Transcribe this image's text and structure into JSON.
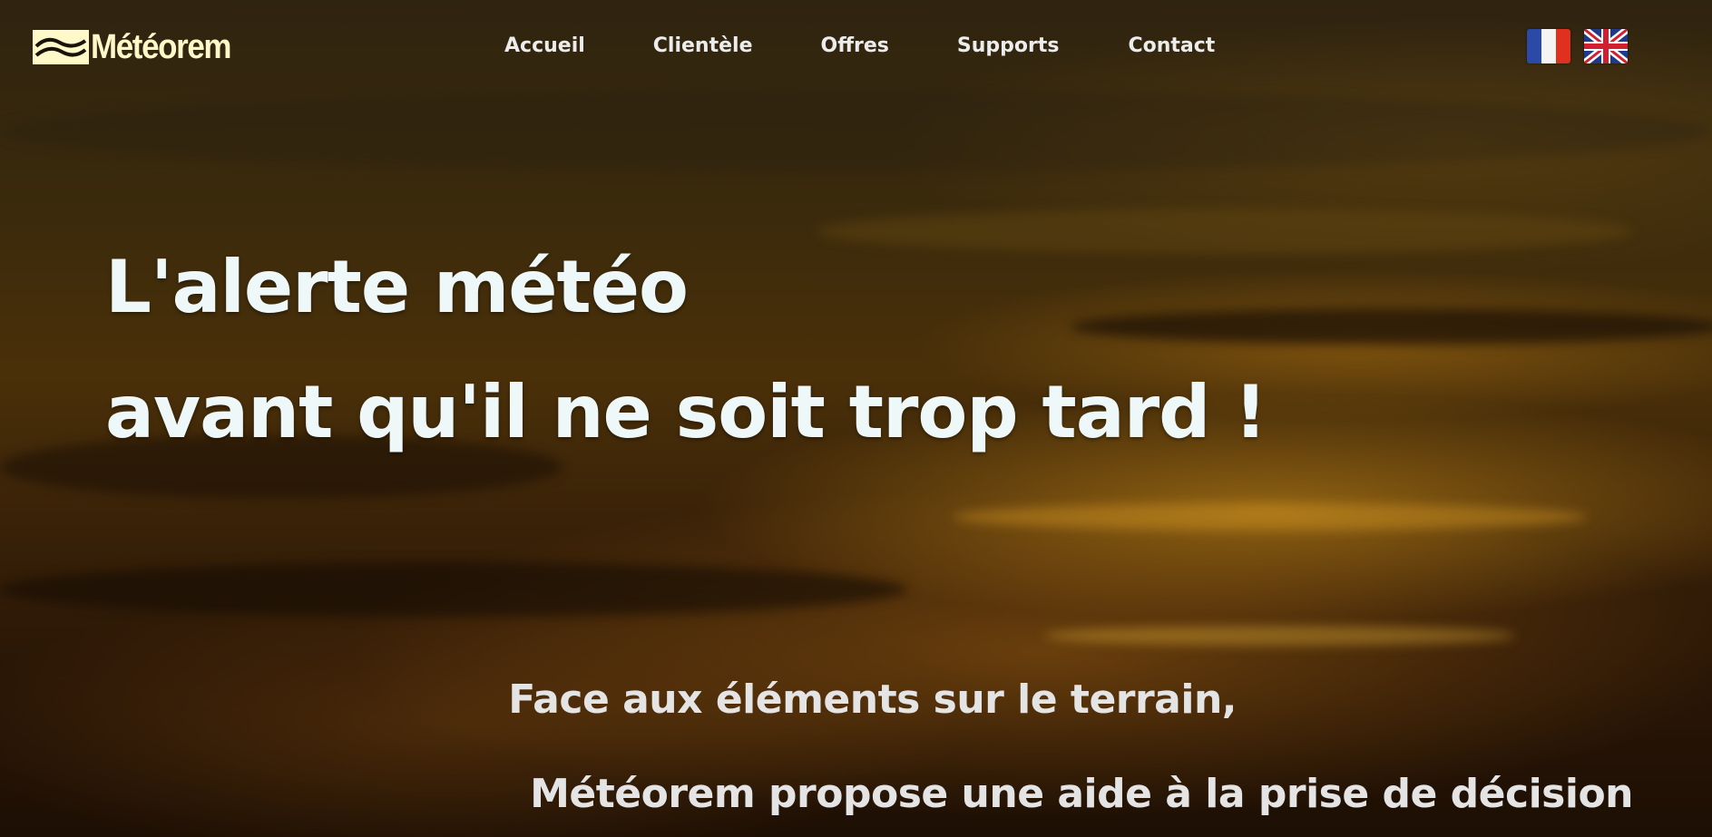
{
  "brand": {
    "name": "Météorem",
    "color": "#fff8c8"
  },
  "nav": {
    "items": [
      {
        "label": "Accueil"
      },
      {
        "label": "Clientèle"
      },
      {
        "label": "Offres"
      },
      {
        "label": "Supports"
      },
      {
        "label": "Contact"
      }
    ]
  },
  "languages": [
    {
      "icon": "flag-france-icon",
      "colors": [
        "#2b4aa8",
        "#f4f4f4",
        "#e0301e"
      ]
    },
    {
      "icon": "flag-uk-icon",
      "colors": [
        "#1f3a8a",
        "#ffffff",
        "#d1202f"
      ]
    }
  ],
  "hero": {
    "headline_line1": "L'alerte météo",
    "headline_line2": "avant qu'il ne soit trop tard !",
    "tagline_line1": "Face aux éléments sur le terrain,",
    "tagline_line2": "Météorem propose une aide à la prise de décision"
  }
}
